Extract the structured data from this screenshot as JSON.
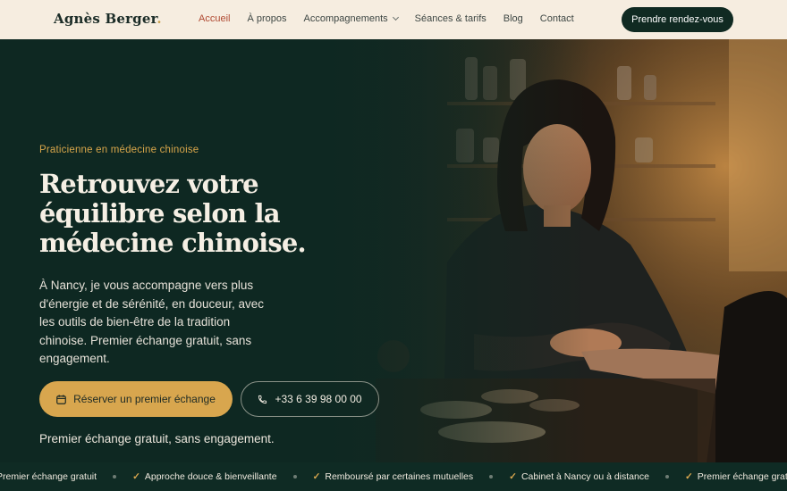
{
  "brand": {
    "name": "Agnès Berger",
    "dot": "."
  },
  "nav": {
    "items": [
      {
        "label": "Accueil",
        "active": true
      },
      {
        "label": "À propos"
      },
      {
        "label": "Accompagnements",
        "dropdown": true
      },
      {
        "label": "Séances & tarifs"
      },
      {
        "label": "Blog"
      },
      {
        "label": "Contact"
      }
    ],
    "cta": "Prendre rendez-vous"
  },
  "hero": {
    "eyebrow": "Praticienne en médecine chinoise",
    "title": "Retrouvez votre équilibre selon la médecine chinoise.",
    "lede": "À Nancy, je vous accompagne vers plus d'énergie et de sérénité, en douceur, avec les outils de bien-être de la tradition chinoise. Premier échange gratuit, sans engagement.",
    "primary_button": {
      "label": "Réserver un premier échange",
      "icon": "calendar-icon"
    },
    "secondary_button": {
      "label": "+33 6 39 98 00 00",
      "icon": "phone-icon"
    },
    "note": "Premier échange gratuit, sans engagement."
  },
  "ticker": {
    "items": [
      "Premier échange gratuit",
      "Approche douce & bienveillante",
      "Remboursé par certaines mutuelles",
      "Cabinet à Nancy ou à distance",
      "Premier échange gratuit"
    ]
  },
  "colors": {
    "accent": "#d8a64e",
    "dark": "#102a22",
    "nav_bg": "#f6ede0",
    "active_link": "#b04a32"
  }
}
